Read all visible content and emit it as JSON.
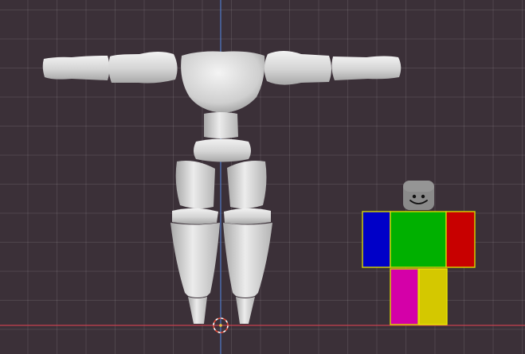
{
  "viewport": {
    "background": "#3b3038",
    "grid_color": "#5a4e57",
    "x_axis_color": "#c7404f",
    "z_axis_color": "#4f79c9"
  },
  "mannequin": {
    "color": "#d7d7d7",
    "shade": "#9c9c9c",
    "parts": [
      "left-upper-arm",
      "left-forearm",
      "right-upper-arm",
      "right-forearm",
      "chest",
      "waist",
      "hips",
      "left-thigh",
      "right-thigh",
      "left-shin",
      "right-shin"
    ]
  },
  "roblox_avatar": {
    "head_color": "#8a8a8a",
    "torso_color": "#00b000",
    "left_arm_color": "#0000c8",
    "right_arm_color": "#c80000",
    "left_leg_color": "#d400a8",
    "right_leg_color": "#d4c800",
    "face": "smile"
  },
  "cursor_3d": {
    "icon": "3d-cursor-icon",
    "ring_colors": [
      "#e34c3c",
      "#ffffff"
    ]
  }
}
